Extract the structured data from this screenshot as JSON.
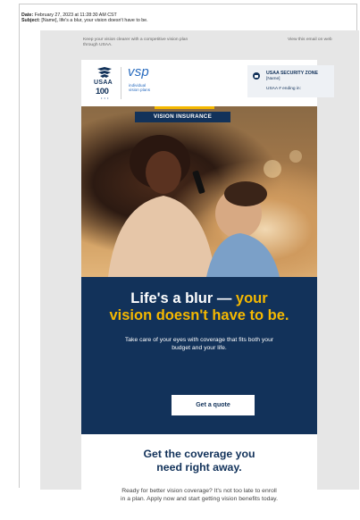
{
  "meta": {
    "date_label": "Date:",
    "date_value": "February 27, 2023 at 11:28:30 AM CST",
    "subject_label": "Subject:",
    "subject_value": "[Name], life's a blur, your vision doesn't have to be."
  },
  "preheader": {
    "left_text": "Keep your vision clearer with a competitive vision plan through USAA.",
    "right_link": "View this email on web"
  },
  "brand": {
    "usaa": "USAA",
    "usaa_100": "100",
    "vsp": "vsp",
    "vsp_sub_1": "individual",
    "vsp_sub_2": "vision plans"
  },
  "security_zone": {
    "title": "USAA SECURITY ZONE",
    "name": "[Name]",
    "account": "USAA # ending in:"
  },
  "hero": {
    "label": "VISION INSURANCE"
  },
  "promo": {
    "headline_white": "Life's a blur — ",
    "headline_yellow_1": "your",
    "headline_yellow_2": "vision doesn't have to be.",
    "body": "Take care of your eyes with coverage that fits both your budget and your life.",
    "cta": "Get a quote"
  },
  "coverage": {
    "heading_1": "Get the coverage you",
    "heading_2": "need right away.",
    "body": "Ready for better vision coverage? It's not too late to enroll in a plan. Apply now and start getting vision benefits today."
  },
  "colors": {
    "navy": "#12325a",
    "gold": "#f5b800",
    "vsp_blue": "#2a6cbf"
  }
}
